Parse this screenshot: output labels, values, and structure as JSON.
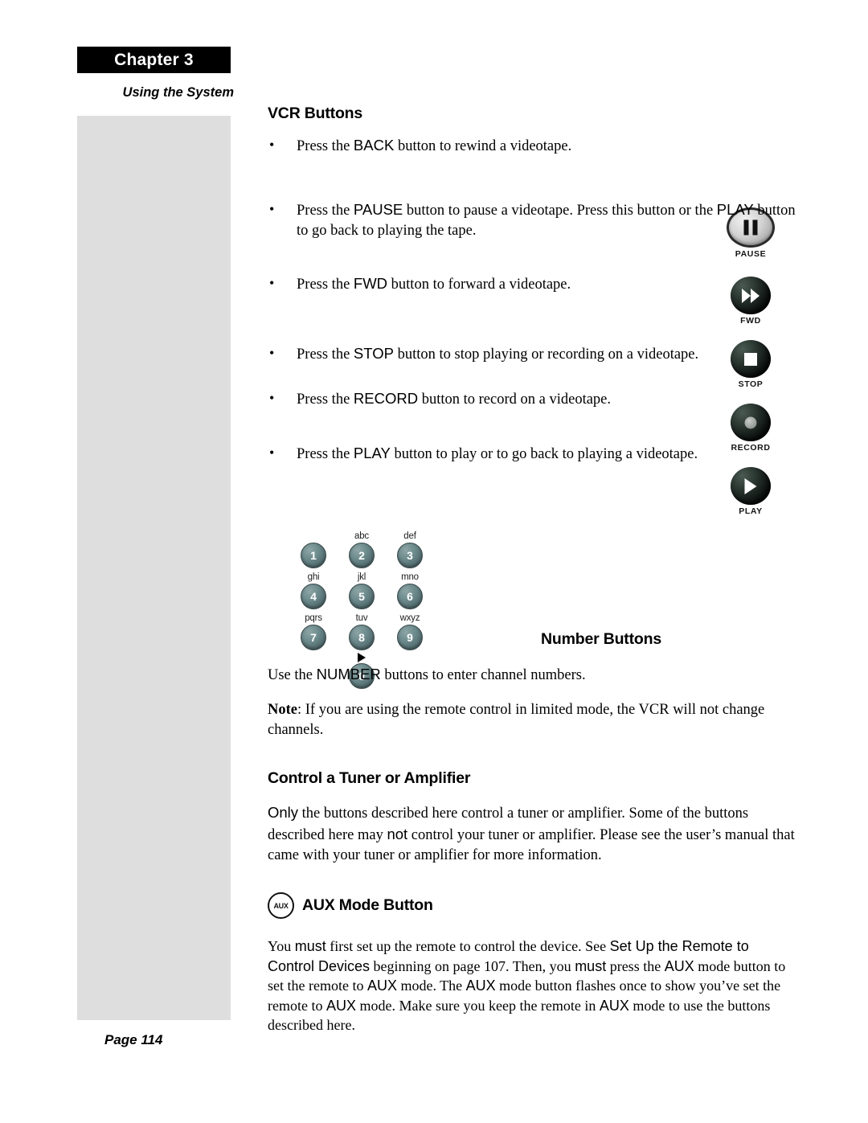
{
  "header": {
    "chapter_label": "Chapter 3",
    "section_label": "Using the System"
  },
  "footer": {
    "page_label": "Page 114"
  },
  "sections": {
    "vcr_heading": "VCR Buttons",
    "number_heading": "Number Buttons",
    "tuner_heading": "Control a Tuner or Amplifier",
    "aux_heading": "AUX Mode Button"
  },
  "bullets": [
    {
      "marker": "•",
      "parts": [
        {
          "text": "Press the ",
          "style": "serif"
        },
        {
          "text": "BACK",
          "style": "sans"
        },
        {
          "text": " button to rewind a videotape.",
          "style": "serif"
        }
      ]
    },
    {
      "marker": "•",
      "parts": [
        {
          "text": "Press the ",
          "style": "serif"
        },
        {
          "text": "PAUSE",
          "style": "sans"
        },
        {
          "text": " button to pause a videotape. Press this button or the ",
          "style": "serif"
        },
        {
          "text": "PLAY",
          "style": "sans"
        },
        {
          "text": " button to go back to playing the tape.",
          "style": "serif"
        }
      ]
    },
    {
      "marker": "•",
      "parts": [
        {
          "text": "Press the ",
          "style": "serif"
        },
        {
          "text": "FWD",
          "style": "sans"
        },
        {
          "text": " button to forward a videotape.",
          "style": "serif"
        }
      ]
    },
    {
      "marker": "•",
      "parts": [
        {
          "text": "Press the ",
          "style": "serif"
        },
        {
          "text": "STOP",
          "style": "sans"
        },
        {
          "text": " button to stop playing or recording on a videotape.",
          "style": "serif"
        }
      ]
    },
    {
      "marker": "•",
      "parts": [
        {
          "text": "Press the ",
          "style": "serif"
        },
        {
          "text": "RECORD",
          "style": "sans"
        },
        {
          "text": " button to record on a videotape.",
          "style": "serif"
        }
      ]
    },
    {
      "marker": "•",
      "parts": [
        {
          "text": "Press the ",
          "style": "serif"
        },
        {
          "text": "PLAY",
          "style": "sans"
        },
        {
          "text": " button to play or to go back to playing a videotape.",
          "style": "serif"
        }
      ]
    }
  ],
  "paragraphs": {
    "number_use": [
      {
        "text": "Use the ",
        "style": "serif"
      },
      {
        "text": "NUMBER",
        "style": "sans"
      },
      {
        "text": " buttons to enter channel numbers.",
        "style": "serif"
      }
    ],
    "number_note": [
      {
        "text": "Note",
        "style": "serif-bold"
      },
      {
        "text": ": If you are using the remote control in limited mode, the VCR will not change channels.",
        "style": "serif"
      }
    ],
    "tuner_body": [
      {
        "text": "Only",
        "style": "sans"
      },
      {
        "text": " the buttons described here control a tuner or amplifier. Some of the buttons described here may ",
        "style": "serif"
      },
      {
        "text": "not",
        "style": "sans"
      },
      {
        "text": " control your tuner or amplifier. Please see the user’s manual that came with your tuner or amplifier for more information.",
        "style": "serif"
      }
    ],
    "aux_body": [
      {
        "text": "You ",
        "style": "serif"
      },
      {
        "text": "must",
        "style": "sans"
      },
      {
        "text": " first set up the remote to control the device. See ",
        "style": "serif"
      },
      {
        "text": "Set Up the Remote to Control Devices",
        "style": "sans"
      },
      {
        "text": " beginning on page 107. Then, you ",
        "style": "serif"
      },
      {
        "text": "must",
        "style": "sans"
      },
      {
        "text": " press the ",
        "style": "serif"
      },
      {
        "text": "AUX",
        "style": "sans"
      },
      {
        "text": " mode button to set the remote to ",
        "style": "serif"
      },
      {
        "text": "AUX",
        "style": "sans"
      },
      {
        "text": " mode. The ",
        "style": "serif"
      },
      {
        "text": "AUX",
        "style": "sans"
      },
      {
        "text": " mode button flashes once to show you’ve set the remote to ",
        "style": "serif"
      },
      {
        "text": "AUX",
        "style": "sans"
      },
      {
        "text": " mode. Make sure you keep the remote in ",
        "style": "serif"
      },
      {
        "text": "AUX",
        "style": "sans"
      },
      {
        "text": " mode to use the buttons described here.",
        "style": "serif"
      }
    ]
  },
  "remote_buttons": [
    {
      "icon": "pause-icon",
      "label": "PAUSE",
      "style": "silver-oval",
      "glyph": "pause-bars"
    },
    {
      "icon": "fwd-icon",
      "label": "FWD",
      "style": "dark-round",
      "glyph": "double-triangle-right"
    },
    {
      "icon": "stop-icon",
      "label": "STOP",
      "style": "dark-round",
      "glyph": "square"
    },
    {
      "icon": "record-icon",
      "label": "RECORD",
      "style": "dark-round",
      "glyph": "circle-dot"
    },
    {
      "icon": "play-icon",
      "label": "PLAY",
      "style": "dark-round",
      "glyph": "triangle-right"
    }
  ],
  "keypad": {
    "rows": [
      [
        {
          "digit": "1",
          "letters": ""
        },
        {
          "digit": "2",
          "letters": "abc"
        },
        {
          "digit": "3",
          "letters": "def"
        }
      ],
      [
        {
          "digit": "4",
          "letters": "ghi"
        },
        {
          "digit": "5",
          "letters": "jkl"
        },
        {
          "digit": "6",
          "letters": "mno"
        }
      ],
      [
        {
          "digit": "7",
          "letters": "pqrs"
        },
        {
          "digit": "8",
          "letters": "tuv"
        },
        {
          "digit": "9",
          "letters": "wxyz"
        }
      ]
    ],
    "zero": {
      "digit": "0",
      "letters": ""
    },
    "zero_marker": "arrow-right-icon"
  },
  "aux_icon_text": "AUX",
  "colors": {
    "rail_gray": "#dedede",
    "chapter_black": "#000000",
    "keypad_teal": "#5d7b7e",
    "text_black": "#000000"
  }
}
